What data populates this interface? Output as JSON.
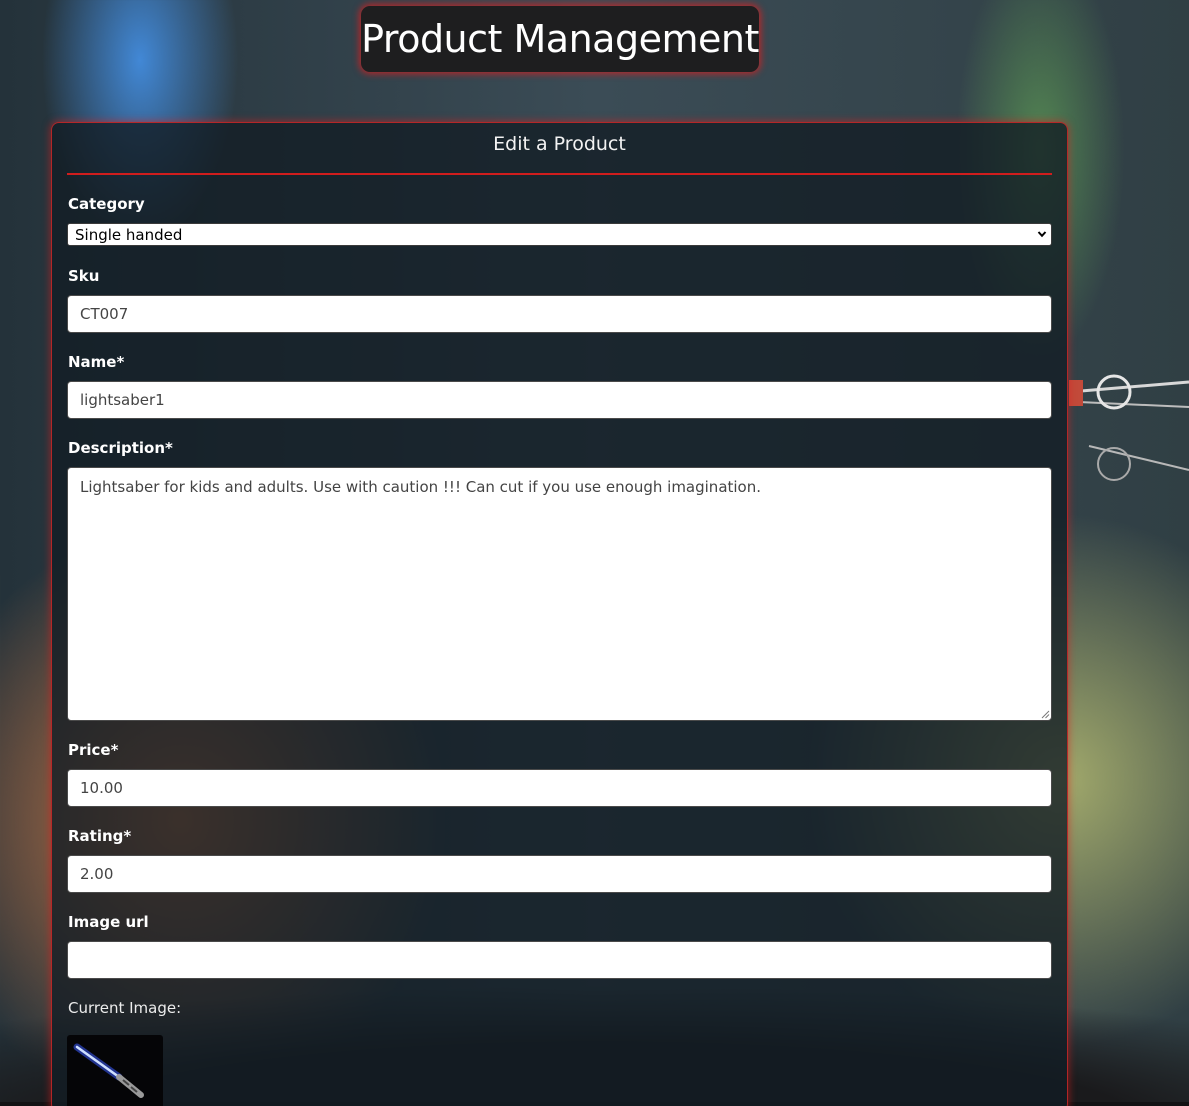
{
  "header": {
    "title": "Product Management"
  },
  "form": {
    "title": "Edit a Product",
    "category": {
      "label": "Category",
      "selected": "Single handed"
    },
    "sku": {
      "label": "Sku",
      "value": "CT007"
    },
    "name": {
      "label": "Name*",
      "value": "lightsaber1"
    },
    "description": {
      "label": "Description*",
      "value": "Lightsaber for kids and adults. Use with caution !!! Can cut if you use enough imagination."
    },
    "price": {
      "label": "Price*",
      "value": "10.00"
    },
    "rating": {
      "label": "Rating*",
      "value": "2.00"
    },
    "image_url": {
      "label": "Image url",
      "value": ""
    },
    "current_image": {
      "label": "Current Image:",
      "icon": "lightsaber-image"
    }
  },
  "colors": {
    "accent": "#d01d1d",
    "panel_bg": "#121c24",
    "header_bg": "#1e1e1f",
    "text_light": "#ffffff",
    "input_text": "#444444"
  }
}
